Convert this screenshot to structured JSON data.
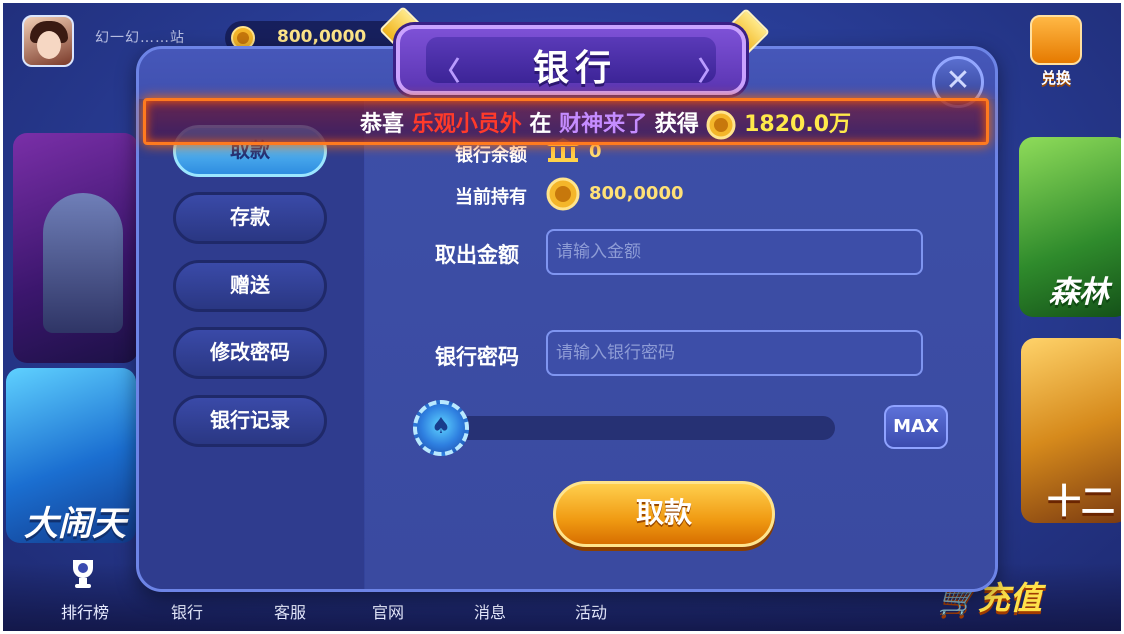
{
  "top_bar": {
    "username": "幻一幻……站",
    "coin_balance": "800,0000",
    "exchange_label": "兑换"
  },
  "side_games": {
    "left_bottom_title": "大闹天",
    "right_top_title": "森林",
    "right_bottom_title": "十二"
  },
  "bottom_nav": [
    {
      "label": "排行榜"
    },
    {
      "label": "银行"
    },
    {
      "label": "客服"
    },
    {
      "label": "官网"
    },
    {
      "label": "消息"
    },
    {
      "label": "活动"
    }
  ],
  "recharge_label": "充值",
  "bank_dialog": {
    "title": "银行",
    "close_symbol": "✕",
    "menu": [
      {
        "label": "取款",
        "active": true
      },
      {
        "label": "存款",
        "active": false
      },
      {
        "label": "赠送",
        "active": false
      },
      {
        "label": "修改密码",
        "active": false
      },
      {
        "label": "银行记录",
        "active": false
      }
    ],
    "bank_balance_label": "银行余额",
    "bank_balance_value": "0",
    "holding_label": "当前持有",
    "holding_value": "800,0000",
    "amount_label": "取出金额",
    "amount_placeholder": "请输入金额",
    "password_label": "银行密码",
    "password_placeholder": "请输入银行密码",
    "slider_value": 0,
    "max_label": "MAX",
    "submit_label": "取款"
  },
  "marquee": {
    "prefix": "恭喜",
    "player": "乐观小员外",
    "at": "在",
    "game": "财神来了",
    "got": "获得",
    "amount": "1820.0万"
  },
  "colors": {
    "accent_gold": "#ffe177",
    "marquee_player": "#ff3a2a",
    "marquee_game": "#c58cff",
    "marquee_amount": "#ffe94a"
  },
  "icons": [
    "coin-icon",
    "bank-building-icon",
    "close-icon",
    "spade-icon",
    "trophy-icon",
    "exchange-icon",
    "cart-icon"
  ]
}
